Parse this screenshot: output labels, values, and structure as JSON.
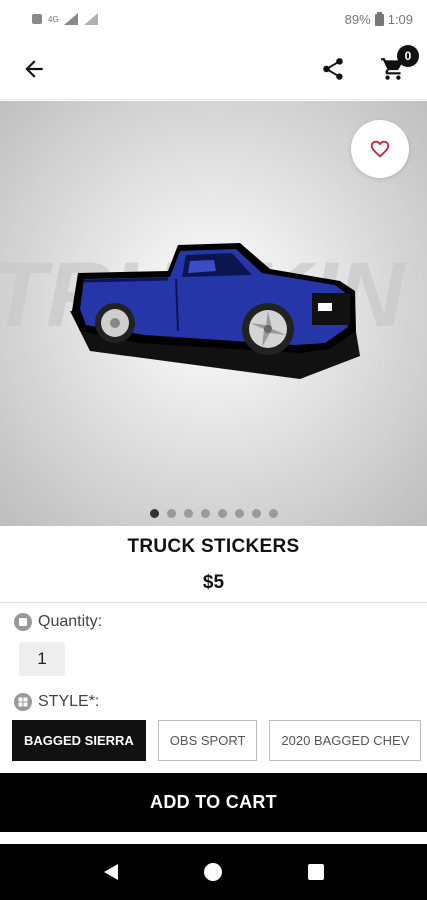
{
  "status_bar": {
    "battery": "89%",
    "time": "1:09",
    "signal_text": "4G"
  },
  "app_bar": {
    "cart_count": "0",
    "icons": [
      "back-arrow-icon",
      "share-icon",
      "cart-icon"
    ]
  },
  "hero": {
    "background_text": "TRUCKIN",
    "dot_count": 8,
    "active_dot": 0
  },
  "product": {
    "title": "TRUCK STICKERS",
    "price": "$5"
  },
  "quantity": {
    "label": "Quantity:",
    "value": "1"
  },
  "style": {
    "label": "STYLE*:",
    "options": [
      "BAGGED SIERRA",
      "OBS SPORT",
      "2020 BAGGED CHEV"
    ],
    "selected_index": 0
  },
  "add_to_cart_label": "ADD TO CART",
  "colors": {
    "accent": "#000000",
    "heart": "#c0283c",
    "truck_body": "#2536a8"
  }
}
